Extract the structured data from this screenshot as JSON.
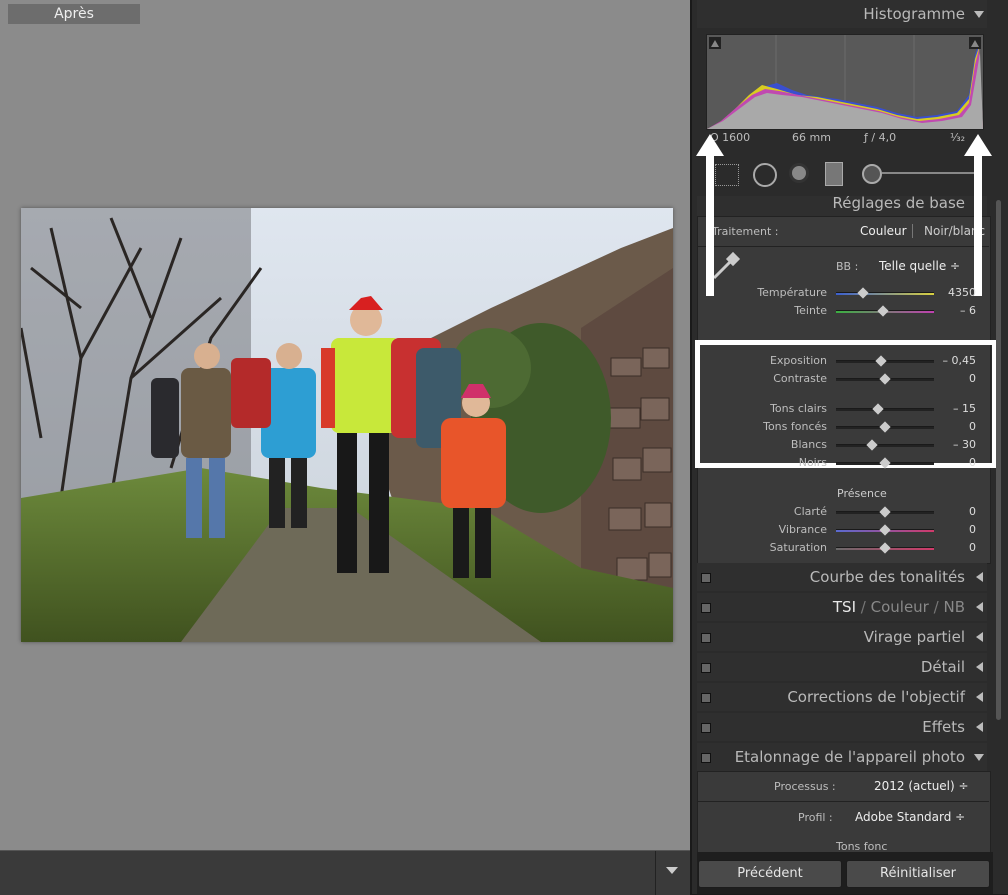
{
  "viewer": {
    "view_label": "Après"
  },
  "histogram": {
    "title": "Histogramme",
    "info": {
      "iso": "O 1600",
      "focal": "66 mm",
      "aperture": "ƒ / 4,0",
      "shutter": "¹⁄₃₂"
    }
  },
  "basic": {
    "title": "Réglages de base",
    "treatment_label": "Traitement :",
    "treatment_color": "Couleur",
    "treatment_bw": "Noir/blanc",
    "wb_label": "BB :",
    "wb_value": "Telle quelle ÷",
    "temperature": {
      "label": "Température",
      "value": "4350",
      "level": 0.28
    },
    "tint": {
      "label": "Teinte",
      "value": "– 6",
      "level": 0.48
    },
    "exposure": {
      "label": "Exposition",
      "value": "– 0,45",
      "level": 0.46
    },
    "contrast": {
      "label": "Contraste",
      "value": "0",
      "level": 0.5
    },
    "highlights": {
      "label": "Tons clairs",
      "value": "– 15",
      "level": 0.43
    },
    "shadows": {
      "label": "Tons foncés",
      "value": "0",
      "level": 0.5
    },
    "whites": {
      "label": "Blancs",
      "value": "– 30",
      "level": 0.37
    },
    "blacks": {
      "label": "Noirs",
      "value": "0",
      "level": 0.5
    },
    "presence_label": "Présence",
    "clarity": {
      "label": "Clarté",
      "value": "0",
      "level": 0.5
    },
    "vibrance": {
      "label": "Vibrance",
      "value": "0",
      "level": 0.5
    },
    "saturation": {
      "label": "Saturation",
      "value": "0",
      "level": 0.5
    }
  },
  "sections": {
    "tone_curve": "Courbe des tonalités",
    "hsl_tsi": "TSI",
    "hsl_color": "Couleur",
    "hsl_nb": "NB",
    "split": "Virage partiel",
    "detail": "Détail",
    "lens": "Corrections de l'objectif",
    "effects": "Effets",
    "calibration": "Etalonnage de l'appareil photo"
  },
  "calibration": {
    "process_label": "Processus :",
    "process_value": "2012 (actuel) ÷",
    "profile_label": "Profil :",
    "profile_value": "Adobe Standard ÷",
    "shadows_label": "Tons fonc"
  },
  "buttons": {
    "previous": "Précédent",
    "reset": "Réinitialiser"
  },
  "colors": {
    "highlight_box": "#ffffff",
    "arrow": "#ffffff",
    "panel": "#2b2b2b",
    "viewer_bg": "#8b8b8b"
  }
}
